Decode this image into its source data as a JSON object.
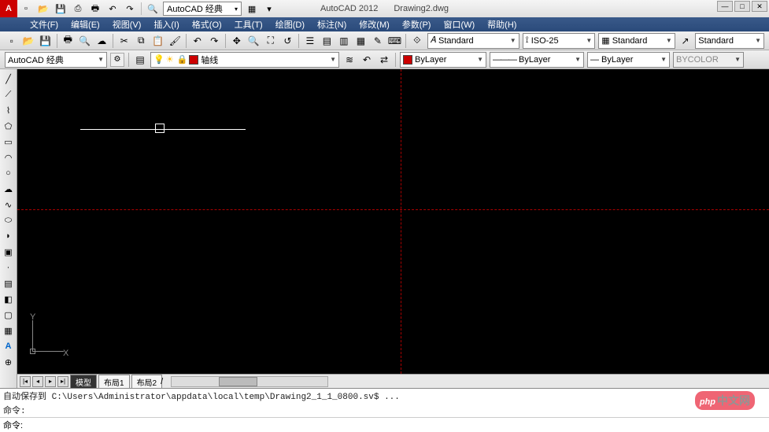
{
  "title": {
    "app": "AutoCAD 2012",
    "doc": "Drawing2.dwg",
    "workspace": "AutoCAD 经典"
  },
  "menu": [
    "文件(F)",
    "编辑(E)",
    "视图(V)",
    "插入(I)",
    "格式(O)",
    "工具(T)",
    "绘图(D)",
    "标注(N)",
    "修改(M)",
    "参数(P)",
    "窗口(W)",
    "帮助(H)"
  ],
  "std_combos": {
    "text_style": "Standard",
    "dim_style": "ISO-25",
    "table_style": "Standard",
    "ml_style": "Standard"
  },
  "ws_combo": "AutoCAD 经典",
  "layer_combo": "轴线",
  "props": {
    "layer": "ByLayer",
    "ltype": "ByLayer",
    "lweight": "ByLayer",
    "pcolor": "BYCOLOR"
  },
  "layer_color": "#c00",
  "bylayer_color": "#c00",
  "tabs": [
    "模型",
    "布局1",
    "布局2"
  ],
  "cmd_history": [
    "自动保存到 C:\\Users\\Administrator\\appdata\\local\\temp\\Drawing2_1_1_0800.sv$ ...",
    "命令:"
  ],
  "cmd_prompt": "命令:",
  "icons": {
    "new": "▫",
    "open": "📂",
    "save": "💾",
    "saveas": "⎙",
    "plot": "🖶",
    "undo": "↶",
    "redo": "↷",
    "search": "🔍",
    "grid": "▦",
    "drop": "▾",
    "cut": "✂",
    "copy": "⧉",
    "paste": "📋",
    "match": "🖌",
    "pan": "✥",
    "zoom": "🔍",
    "zoome": "⛶",
    "sun": "☀",
    "bulb": "💡",
    "lock": "🔒",
    "color": "■",
    "line": "╱",
    "cline": "⟋",
    "pline": "⌇",
    "poly": "⬠",
    "rect": "▭",
    "arc": "◠",
    "circle": "○",
    "cloud": "☁",
    "spline": "∿",
    "ellipse": "⬭",
    "earc": "◗",
    "point": "·",
    "block": "▣",
    "hatch": "▤",
    "grad": "◧",
    "region": "▢",
    "table": "▦",
    "text": "A",
    "mtext": "A"
  },
  "ucs": {
    "x": "X",
    "y": "Y"
  },
  "watermark": {
    "brand": "php",
    "suffix": "中文网"
  }
}
